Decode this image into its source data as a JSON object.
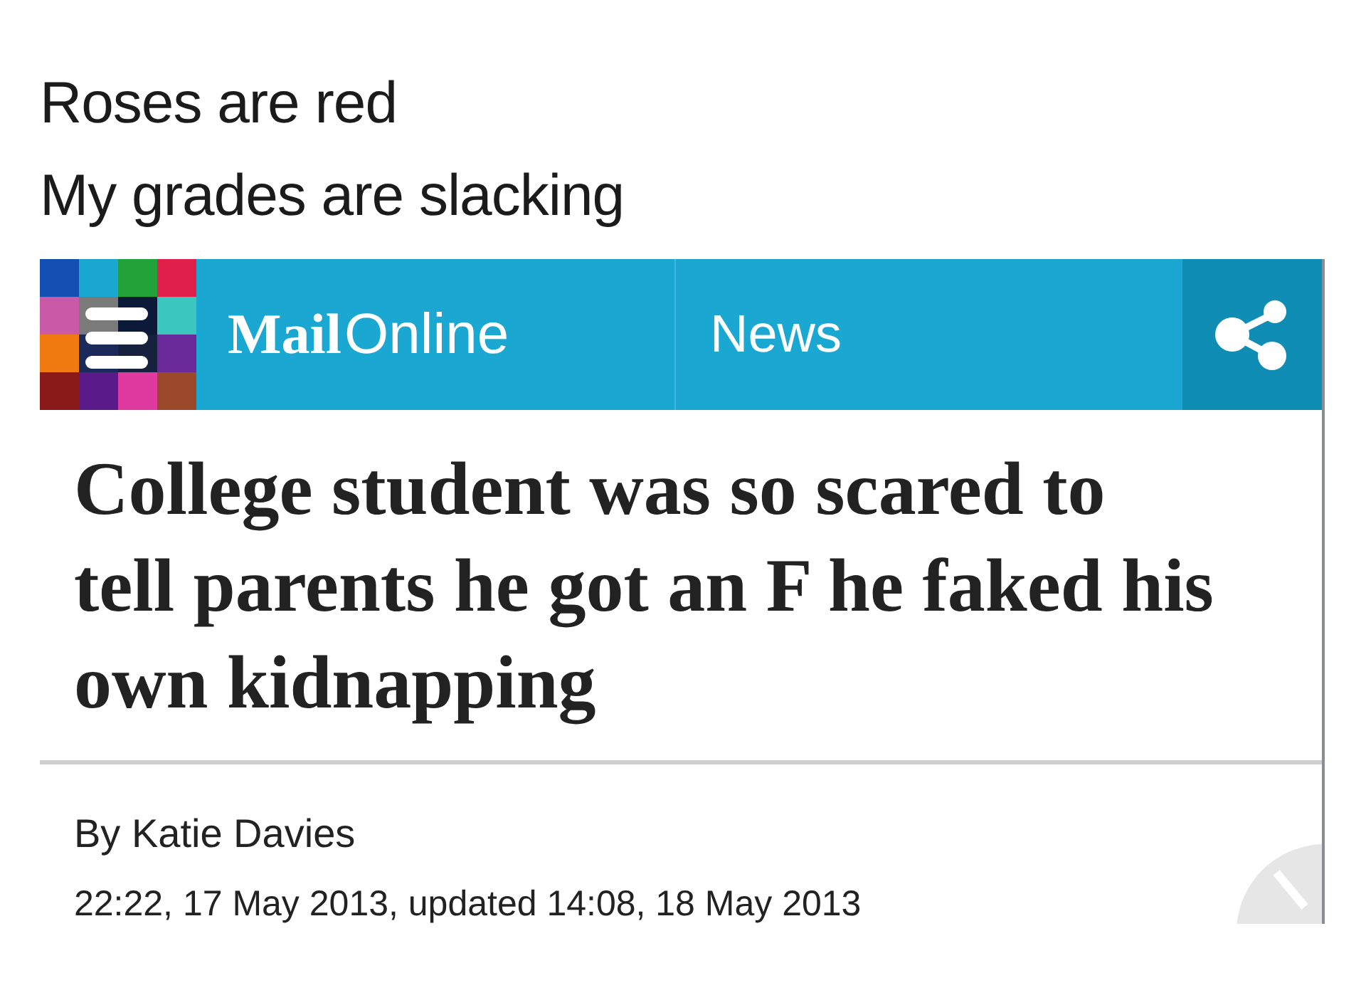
{
  "caption": [
    "Roses are red",
    "My grades are slacking"
  ],
  "header": {
    "brand": "Mail",
    "brand_suffix": "Online",
    "section": "News"
  },
  "article": {
    "headline": "College student was so scared to tell parents he got an F he faked his own kidnapping",
    "byline": "By Katie Davies",
    "dateline": "22:22, 17 May 2013, updated 14:08, 18 May 2013"
  }
}
